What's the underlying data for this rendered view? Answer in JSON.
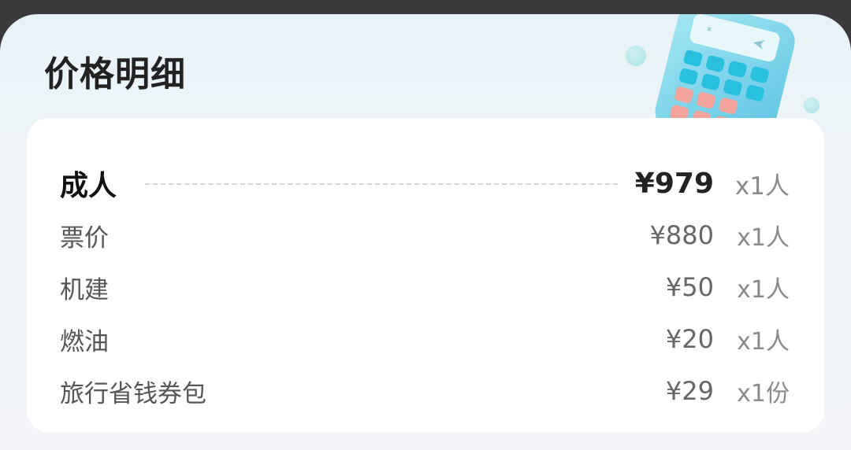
{
  "panel": {
    "title": "价格明细"
  },
  "rows": [
    {
      "label": "成人",
      "price": "¥979",
      "qty": "x1人"
    },
    {
      "label": "票价",
      "price": "¥880",
      "qty": "x1人"
    },
    {
      "label": "机建",
      "price": "¥50",
      "qty": "x1人"
    },
    {
      "label": "燃油",
      "price": "¥20",
      "qty": "x1人"
    },
    {
      "label": "旅行省钱券包",
      "price": "¥29",
      "qty": "x1份"
    }
  ],
  "colors": {
    "sheet_bg": "#eef4f8",
    "card_bg": "#ffffff",
    "title_text": "#222222",
    "secondary_text": "#666666",
    "calculator_body": "#7fd3ea",
    "calculator_key_teal": "#27c1dd",
    "calculator_key_pink": "#f4a49a"
  },
  "icons": {
    "illustration": "calculator-icon"
  }
}
